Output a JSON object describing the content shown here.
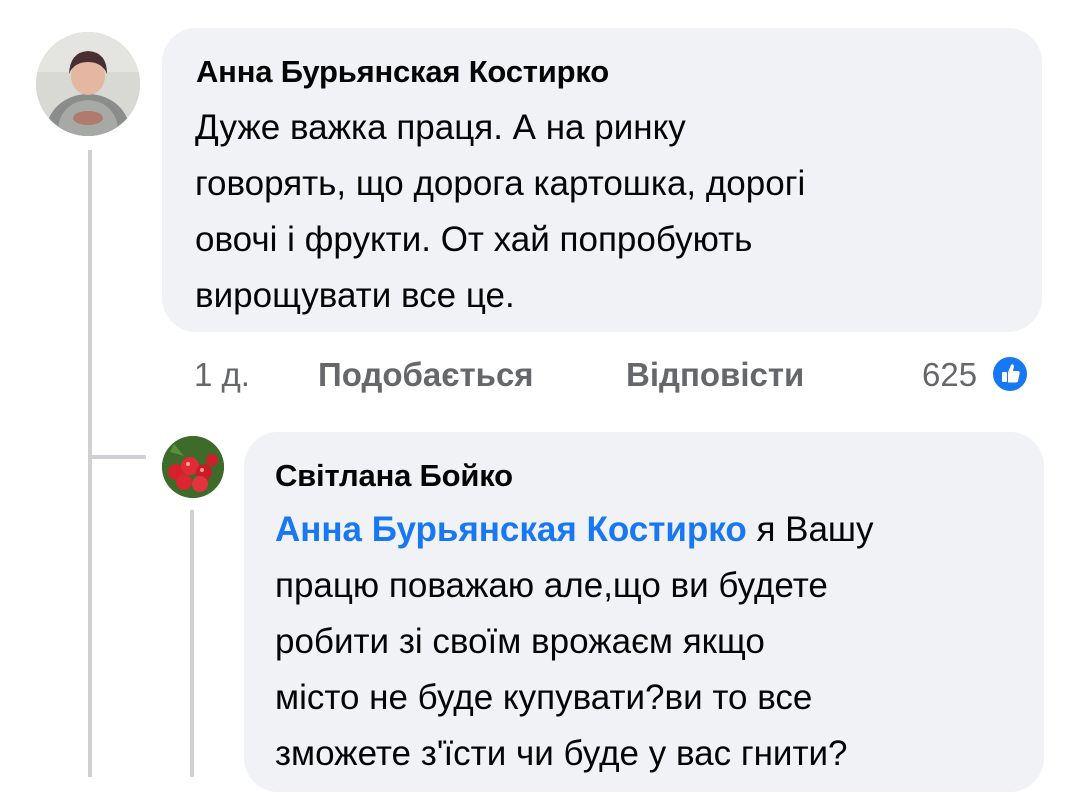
{
  "comment": {
    "author": "Анна Бурьянская Костирко",
    "text": "Дуже важка праця. А на ринку\nговорять, що дорога картошка, дорогі\nовочі і фрукти. От хай попробують\nвирощувати все це.",
    "time": "1 д.",
    "like_label": "Подобається",
    "reply_label": "Відповісти",
    "reaction_count": "625",
    "reaction_icon": "like-icon",
    "colors": {
      "reaction": "#1877f2",
      "bubble": "#f0f2f5"
    }
  },
  "reply": {
    "author": "Світлана Бойко",
    "mention": "Анна Бурьянская Костирко",
    "text_first": " я Вашу",
    "text_rest": "працю поважаю але,що ви будете\nробити зі своїм врожаєм якщо\nмісто не буде купувати?ви то все\nзможете з'їсти чи буде у вас гнити?",
    "colors": {
      "mention": "#1877f2"
    }
  }
}
